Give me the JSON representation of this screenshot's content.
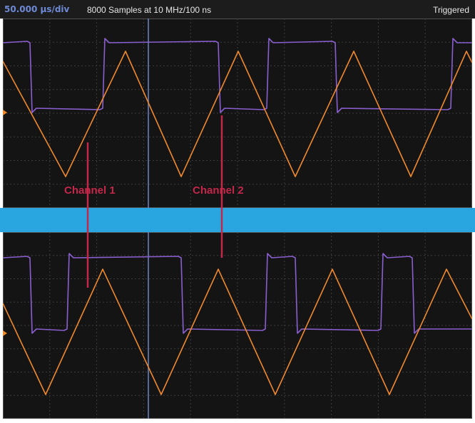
{
  "header": {
    "timebase": "50.000 µs/div",
    "samples": "8000 Samples at 10 MHz/100 ns",
    "trigger_status": "Triggered"
  },
  "annotations": {
    "channel1_label": "Channel 1",
    "channel2_label": "Channel 2"
  },
  "colors": {
    "background": "#141414",
    "grid": "#3c3c3c",
    "square_wave_trace": "#8a5fd0",
    "triangle_wave_trace": "#f0892a",
    "cursor": "#6b86c8",
    "annotation": "#c4274a",
    "divider_band": "#29a6df"
  },
  "traces": {
    "square_wave_color_name": "purple",
    "triangle_wave_color_name": "orange"
  }
}
